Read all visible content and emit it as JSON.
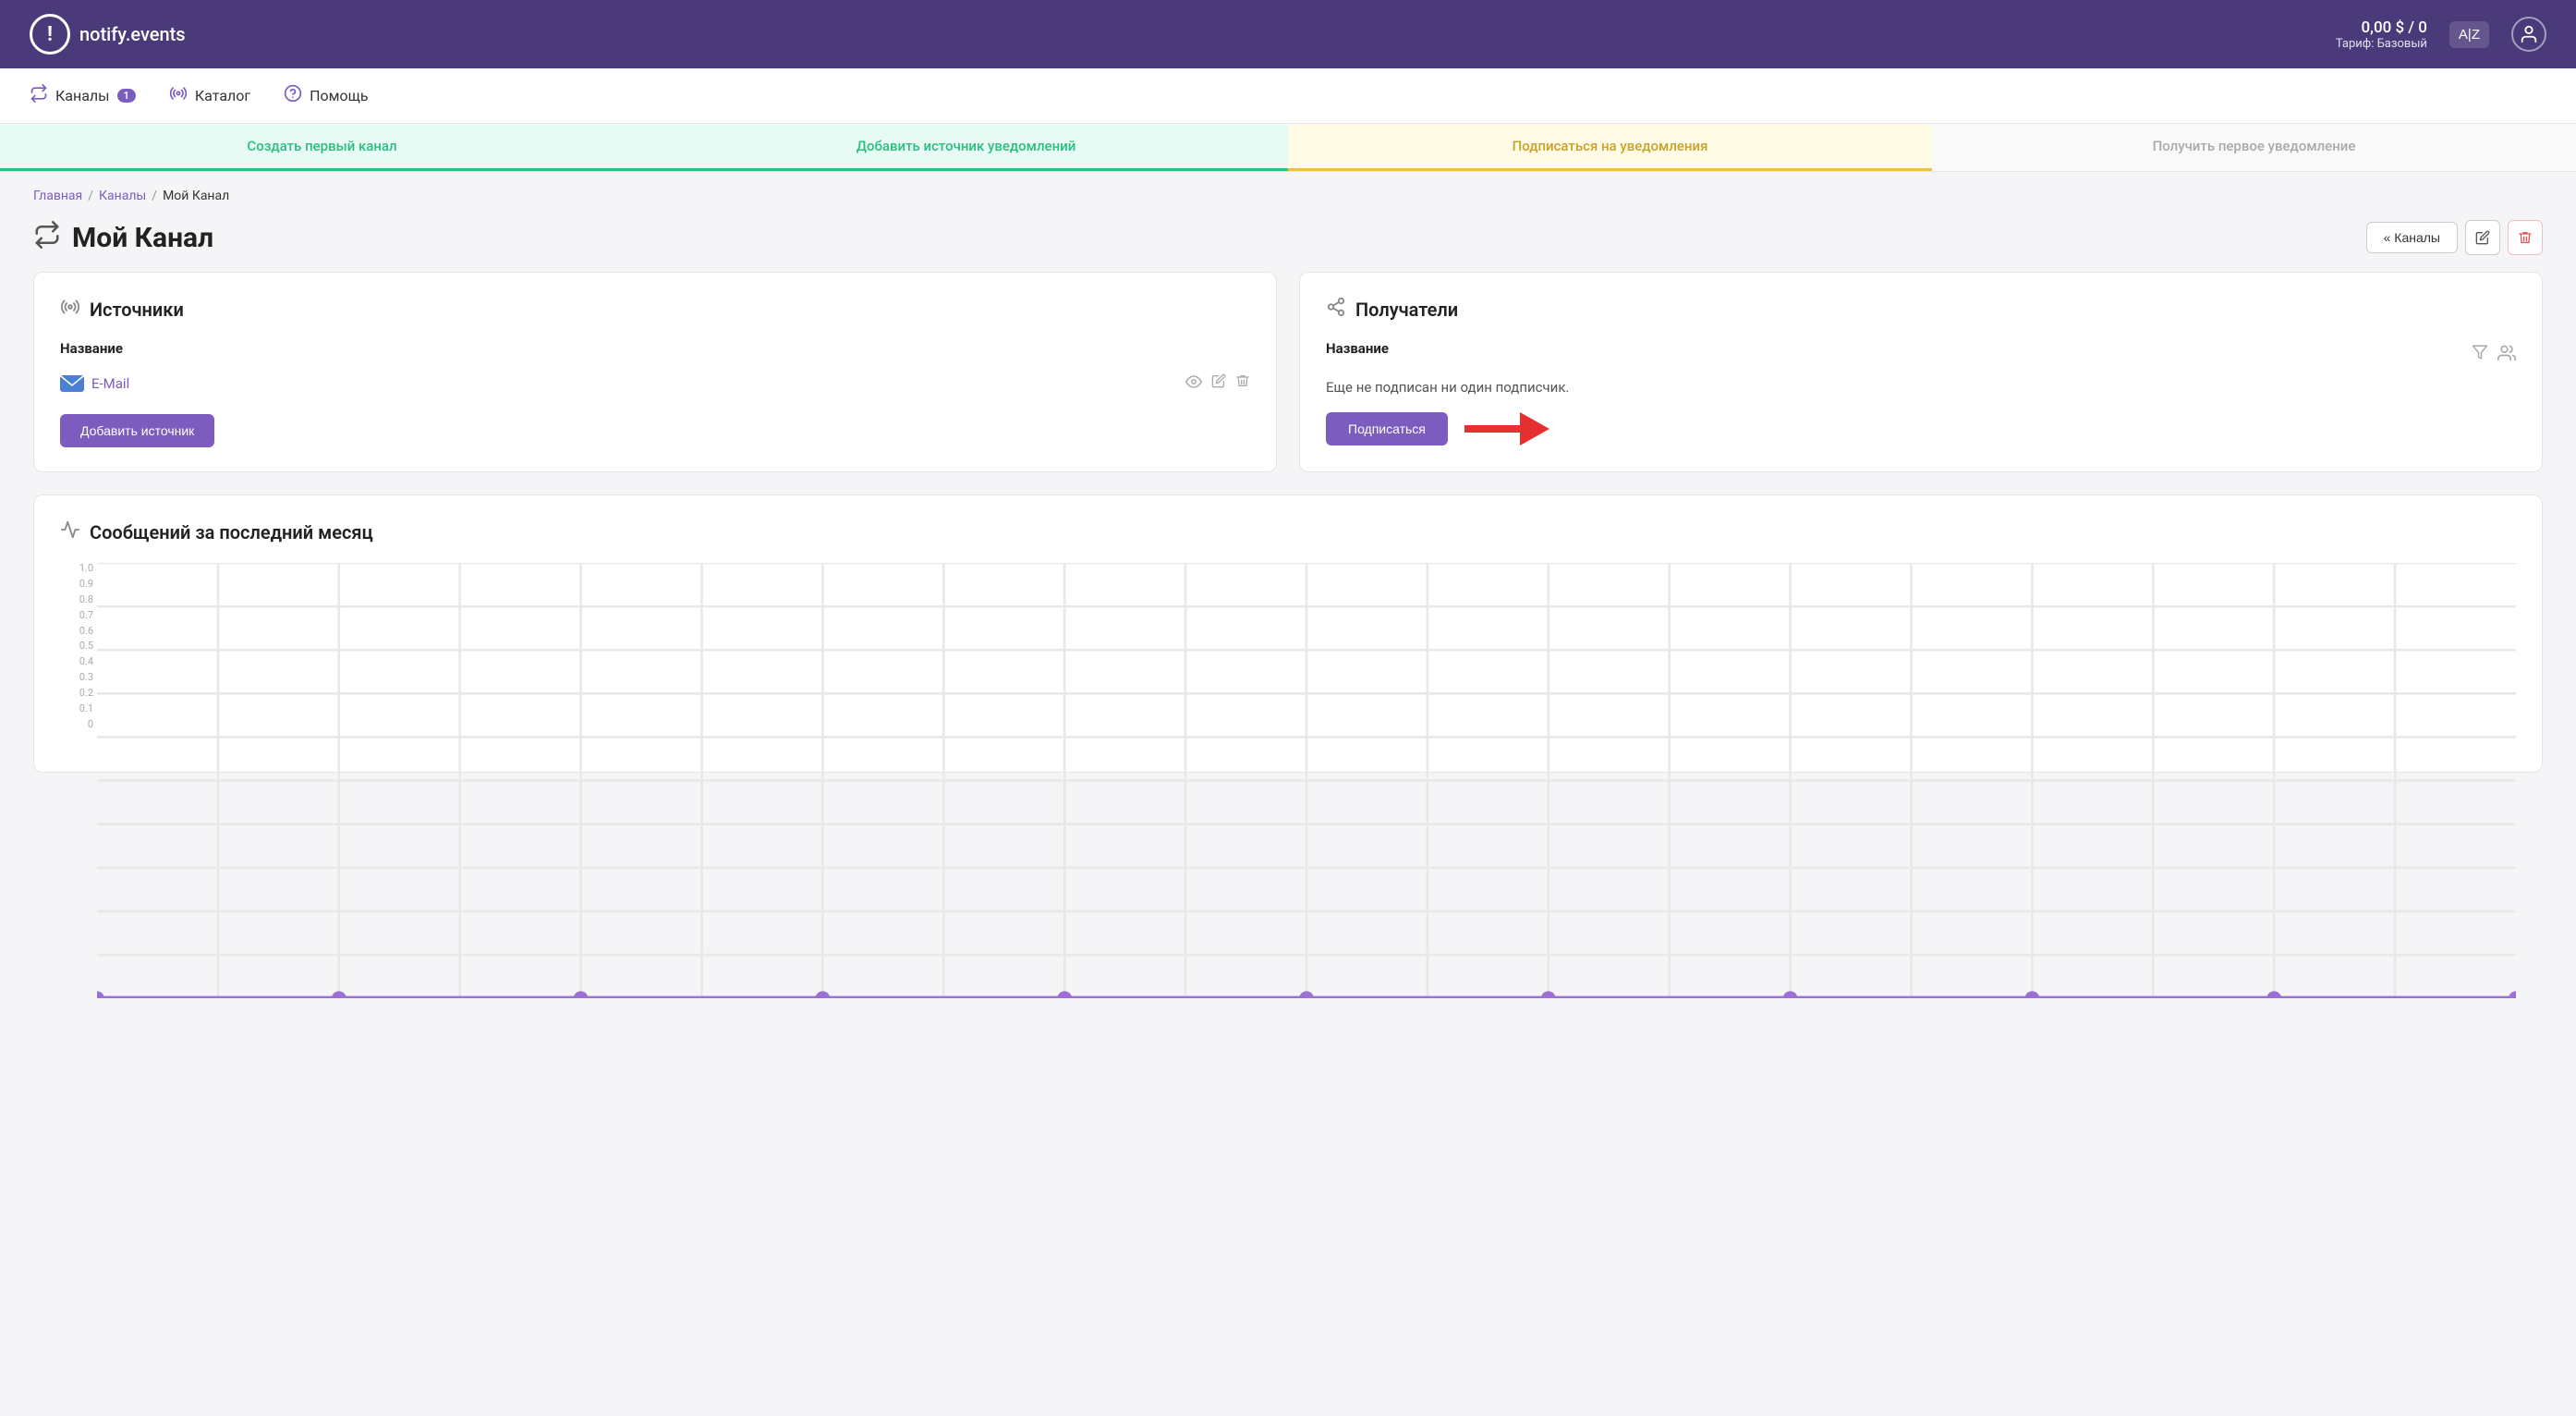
{
  "header": {
    "logo_icon": "!",
    "logo_text": "notify.events",
    "balance_amount": "0,00 $ / 0",
    "balance_plan_label": "Тариф: Базовый",
    "lang_btn": "A|Z",
    "user_icon": "👤"
  },
  "nav": {
    "items": [
      {
        "id": "channels",
        "icon": "⇌",
        "label": "Каналы",
        "badge": "1"
      },
      {
        "id": "catalog",
        "icon": "📡",
        "label": "Каталог"
      },
      {
        "id": "help",
        "icon": "?",
        "label": "Помощь"
      }
    ]
  },
  "steps": [
    {
      "id": "create-channel",
      "label": "Создать первый канал",
      "state": "done"
    },
    {
      "id": "add-source",
      "label": "Добавить источник уведомлений",
      "state": "done"
    },
    {
      "id": "subscribe",
      "label": "Подписаться на уведомления",
      "state": "active"
    },
    {
      "id": "first-notification",
      "label": "Получить первое уведомление",
      "state": "inactive"
    }
  ],
  "breadcrumb": {
    "home": "Главная",
    "sep1": "/",
    "channels": "Каналы",
    "sep2": "/",
    "current": "Мой Канал"
  },
  "page": {
    "title_icon": "⇌",
    "title": "Мой Канал",
    "back_btn": "« Каналы",
    "edit_icon": "✏",
    "delete_icon": "🗑"
  },
  "sources_card": {
    "icon": "📡",
    "title": "Источники",
    "col_name": "Название",
    "sources": [
      {
        "id": "email",
        "icon": "email",
        "name": "E-Mail"
      }
    ],
    "view_icon": "👁",
    "edit_icon": "✏",
    "delete_icon": "🗑",
    "add_btn": "Добавить источник"
  },
  "recipients_card": {
    "icon": "🔗",
    "title": "Получатели",
    "col_name": "Название",
    "filter_icon": "▽",
    "users_icon": "👥",
    "no_subscribers": "Еще не подписан ни один подписчик.",
    "subscribe_btn": "Подписаться"
  },
  "chart": {
    "icon": "📈",
    "title": "Сообщений за последний месяц",
    "y_labels": [
      "1.0",
      "0.9",
      "0.8",
      "0.7",
      "0.6",
      "0.5",
      "0.4",
      "0.3",
      "0.2",
      "0.1",
      "0"
    ],
    "x_labels": []
  }
}
